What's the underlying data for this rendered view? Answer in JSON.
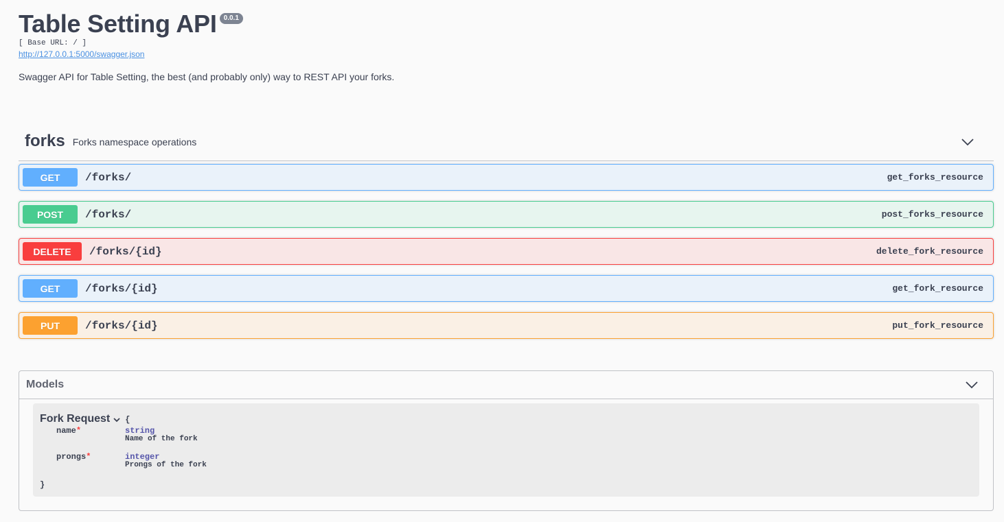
{
  "info": {
    "title": "Table Setting API",
    "version": "0.0.1",
    "base_url": "[ Base URL: / ]",
    "spec_link": "http://127.0.0.1:5000/swagger.json",
    "description": "Swagger API for Table Setting, the best (and probably only) way to REST API your forks."
  },
  "tag": {
    "name": "forks",
    "description": "Forks namespace operations",
    "icon": "chevron-down-icon"
  },
  "operations": [
    {
      "method": "GET",
      "path": "/forks/",
      "operation_id": "get_forks_resource",
      "color": "#61affe"
    },
    {
      "method": "POST",
      "path": "/forks/",
      "operation_id": "post_forks_resource",
      "color": "#49cc90"
    },
    {
      "method": "DELETE",
      "path": "/forks/{id}",
      "operation_id": "delete_fork_resource",
      "color": "#f93e3e"
    },
    {
      "method": "GET",
      "path": "/forks/{id}",
      "operation_id": "get_fork_resource",
      "color": "#61affe"
    },
    {
      "method": "PUT",
      "path": "/forks/{id}",
      "operation_id": "put_fork_resource",
      "color": "#fca130"
    }
  ],
  "models": {
    "title": "Models",
    "icon": "chevron-down-icon",
    "model": {
      "name": "Fork Request",
      "toggle_icon": "chevron-down-icon",
      "open_brace": "{",
      "close_brace": "}",
      "properties": [
        {
          "name": "name",
          "required_mark": "*",
          "type": "string",
          "description": "Name of the fork"
        },
        {
          "name": "prongs",
          "required_mark": "*",
          "type": "integer",
          "description": "Prongs of the fork"
        }
      ]
    }
  }
}
